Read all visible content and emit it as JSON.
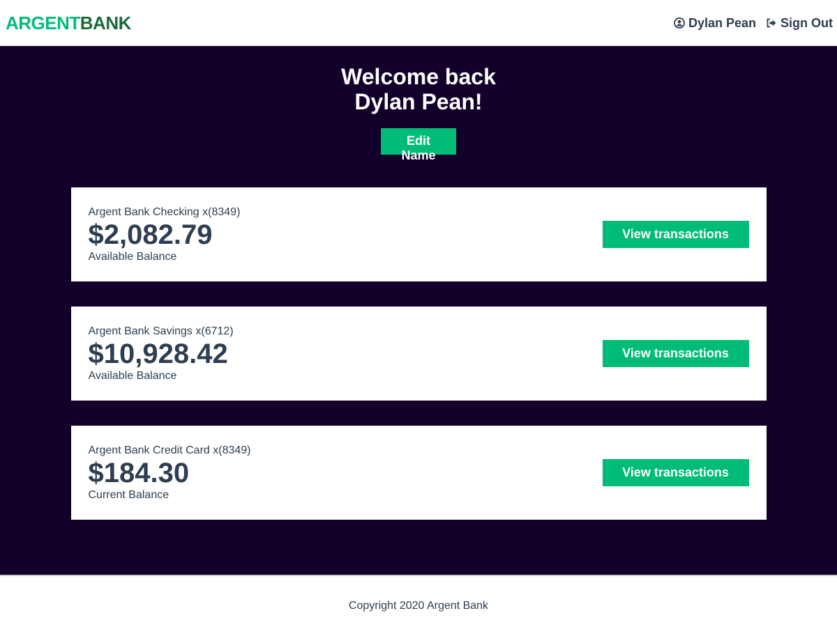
{
  "header": {
    "logo_part1": "ARGENT",
    "logo_part2": "BANK",
    "user_name": "Dylan Pean",
    "sign_out_label": "Sign Out",
    "colors": {
      "logo_argent": "#00bc77",
      "logo_bank": "#1a6b3a",
      "nav_text": "#2c3e50"
    }
  },
  "hero": {
    "line1": "Welcome back",
    "line2": "Dylan Pean!",
    "edit_button_label": "Edit Name",
    "background_color": "#12002b"
  },
  "accounts": [
    {
      "title": "Argent Bank Checking x(8349)",
      "amount": "$2,082.79",
      "description": "Available Balance",
      "button_label": "View transactions"
    },
    {
      "title": "Argent Bank Savings x(6712)",
      "amount": "$10,928.42",
      "description": "Available Balance",
      "button_label": "View transactions"
    },
    {
      "title": "Argent Bank Credit Card x(8349)",
      "amount": "$184.30",
      "description": "Current Balance",
      "button_label": "View transactions"
    }
  ],
  "footer": {
    "text": "Copyright 2020 Argent Bank"
  },
  "colors": {
    "accent": "#00bc77",
    "dark_background": "#12002b",
    "text": "#2c3e50"
  },
  "icons": {
    "user": "user-circle-icon",
    "sign_out": "sign-out-icon"
  }
}
